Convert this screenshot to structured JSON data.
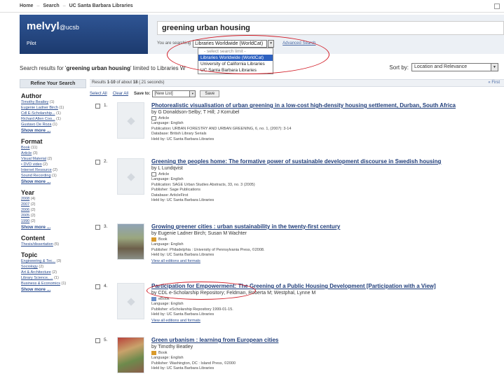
{
  "topnav": {
    "items": [
      "Home",
      "Search",
      "UC Santa Barbara Libraries"
    ],
    "sep": "–"
  },
  "banner": {
    "brand": "melvyl",
    "brand_suffix": "@ucsb",
    "pilot": "Pilot",
    "query": "greening urban housing",
    "scope_label": "You are searching",
    "scope_value": "Libraries Worldwide (WorldCat)",
    "advanced": "Advanced Search"
  },
  "scope_dropdown": {
    "header": "- select search limit -",
    "options": [
      "Libraries Worldwide (WorldCat)",
      "University of California Libraries",
      "UC Santa Barbara Libraries"
    ],
    "selected_index": 0
  },
  "results_line": {
    "prefix": "Search results for '",
    "query": "greening urban housing",
    "suffix": "' limited to Libraries W"
  },
  "sort": {
    "label": "Sort by:",
    "value": "Location and Relevance"
  },
  "sidebar": {
    "heading": "Refine Your Search",
    "facets": [
      {
        "title": "Author",
        "items": [
          {
            "label": "Timothy Beatley",
            "count": "(1)"
          },
          {
            "label": "Eugenie Ladner Birch",
            "count": "(1)"
          },
          {
            "label": "Cdl E-Scholarship...",
            "count": "(1)"
          },
          {
            "label": "Richard Allen Coo...",
            "count": "(1)"
          },
          {
            "label": "Gustavo De Roza",
            "count": "(1)"
          }
        ],
        "more": "Show more ..."
      },
      {
        "title": "Format",
        "items": [
          {
            "label": "Book",
            "count": "(11)"
          },
          {
            "label": "Article",
            "count": "(3)"
          },
          {
            "label": "Visual Material",
            "count": "(2)"
          },
          {
            "label": "• DVD video",
            "count": "(2)"
          },
          {
            "label": "Internet Resource",
            "count": "(2)"
          },
          {
            "label": "Sound Recording",
            "count": "(1)"
          }
        ],
        "more": "Show more ..."
      },
      {
        "title": "Year",
        "items": [
          {
            "label": "2008",
            "count": "(4)"
          },
          {
            "label": "2007",
            "count": "(2)"
          },
          {
            "label": "2006",
            "count": "(2)"
          },
          {
            "label": "2005",
            "count": "(2)"
          },
          {
            "label": "1990",
            "count": "(2)"
          }
        ],
        "more": "Show more ..."
      },
      {
        "title": "Content",
        "items": [
          {
            "label": "Thesis/dissertation",
            "count": "(5)"
          }
        ],
        "more": ""
      },
      {
        "title": "Topic",
        "items": [
          {
            "label": "Engineering & Tec...",
            "count": "(3)"
          },
          {
            "label": "Sociology",
            "count": "(2)"
          },
          {
            "label": "Art & Architecture",
            "count": "(2)"
          },
          {
            "label": "Library Science, ...",
            "count": "(1)"
          },
          {
            "label": "Business & Economics",
            "count": "(1)"
          }
        ],
        "more": "Show more ..."
      }
    ]
  },
  "results_bar": {
    "prefix": "Results ",
    "range": "1-10",
    "suffix": " of about ",
    "total": "18",
    "time": " (.21 seconds)",
    "first": "« First"
  },
  "toolbar": {
    "select_all": "Select All",
    "clear_all": "Clear All",
    "save_to": "Save to:",
    "list_value": "[New List]",
    "save_button": "Save"
  },
  "results": [
    {
      "num": "1.",
      "thumb": "placeholder",
      "title": "Photorealistic visualisation of urban greening in a low-cost high-density housing settlement, Durban, South Africa",
      "by": "by G Donaldson-Selby; T Hill; J Korrubel",
      "format": "Article",
      "format_icon": "article",
      "meta": [
        "Language: English",
        "Publication: URBAN FORESTRY AND URBAN GREENING, 6, no. 1, (2007): 3-14",
        "Database: British Library Serials",
        "Held by: UC Santa Barbara Libraries"
      ],
      "view_all": ""
    },
    {
      "num": "2.",
      "thumb": "placeholder",
      "title": "Greening the peoples home: The formative power of sustainable development discourse in Swedish housing",
      "by": "by L Lundqvist",
      "format": "Article",
      "format_icon": "article",
      "meta": [
        "Language: English",
        "Publication: SAGE Urban Studies Abstracts, 33, no. 3 (2005)",
        "Publisher: Sage Publications",
        "Database: ArticleFirst",
        "Held by: UC Santa Barbara Libraries"
      ],
      "view_all": ""
    },
    {
      "num": "3.",
      "thumb": "photo1",
      "title": "Growing greener cities : urban sustainability in the twenty-first century",
      "by": "by Eugenie Ladner Birch; Susan M Wachter",
      "format": "Book",
      "format_icon": "book",
      "meta": [
        "Language: English",
        "Publisher: Philadelphia : University of Pennsylvania Press, ©2008.",
        "Held by: UC Santa Barbara Libraries"
      ],
      "view_all": "View all editions and formats"
    },
    {
      "num": "4.",
      "thumb": "placeholder",
      "title": "Participation for Empowerment: The Greening of a Public Housing Development [Participation with a View]",
      "by": "by CDL e-Scholarship Repository; Feldman, Roberta M; Westphal, Lynne M",
      "format": "eBook",
      "format_icon": "ebook",
      "meta": [
        "Language: English",
        "Publisher: eScholarship Repository 1999-01-15.",
        "Held by: UC Santa Barbara Libraries"
      ],
      "view_all": "View all editions and formats"
    },
    {
      "num": "5.",
      "thumb": "photo2",
      "title": "Green urbanism : learning from European cities",
      "by": "by Timothy Beatley",
      "format": "Book",
      "format_icon": "book",
      "meta": [
        "Language: English",
        "Publisher: Washington, DC : Island Press, ©2000",
        "Held by: UC Santa Barbara Libraries"
      ],
      "view_all": ""
    }
  ],
  "annotation_color": "#d21c26"
}
